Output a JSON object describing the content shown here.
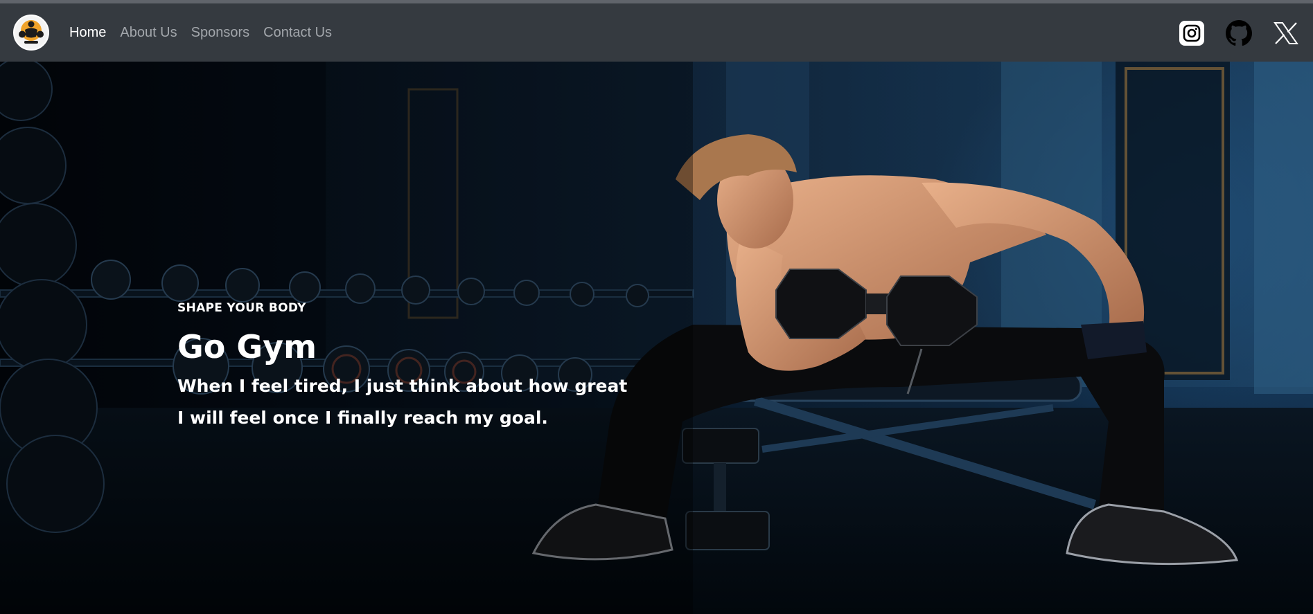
{
  "nav": {
    "logo_icon": "gym-logo-icon",
    "links": [
      {
        "label": "Home",
        "active": true
      },
      {
        "label": "About Us",
        "active": false
      },
      {
        "label": "Sponsors",
        "active": false
      },
      {
        "label": "Contact Us",
        "active": false
      }
    ],
    "social": [
      {
        "icon": "instagram-icon"
      },
      {
        "icon": "github-icon"
      },
      {
        "icon": "x-icon"
      }
    ]
  },
  "hero": {
    "eyebrow": "SHAPE YOUR BODY",
    "headline": "Go Gym",
    "tagline_line1": "When I feel tired, I just think about how great",
    "tagline_line2": "I will feel once I finally reach my goal.",
    "image": "man-lifting-dumbbell-photo"
  },
  "colors": {
    "navbar": "#353a40",
    "nav_active": "#ffffff",
    "nav_inactive": "#a2a6ab",
    "hero_text": "#ffffff"
  }
}
